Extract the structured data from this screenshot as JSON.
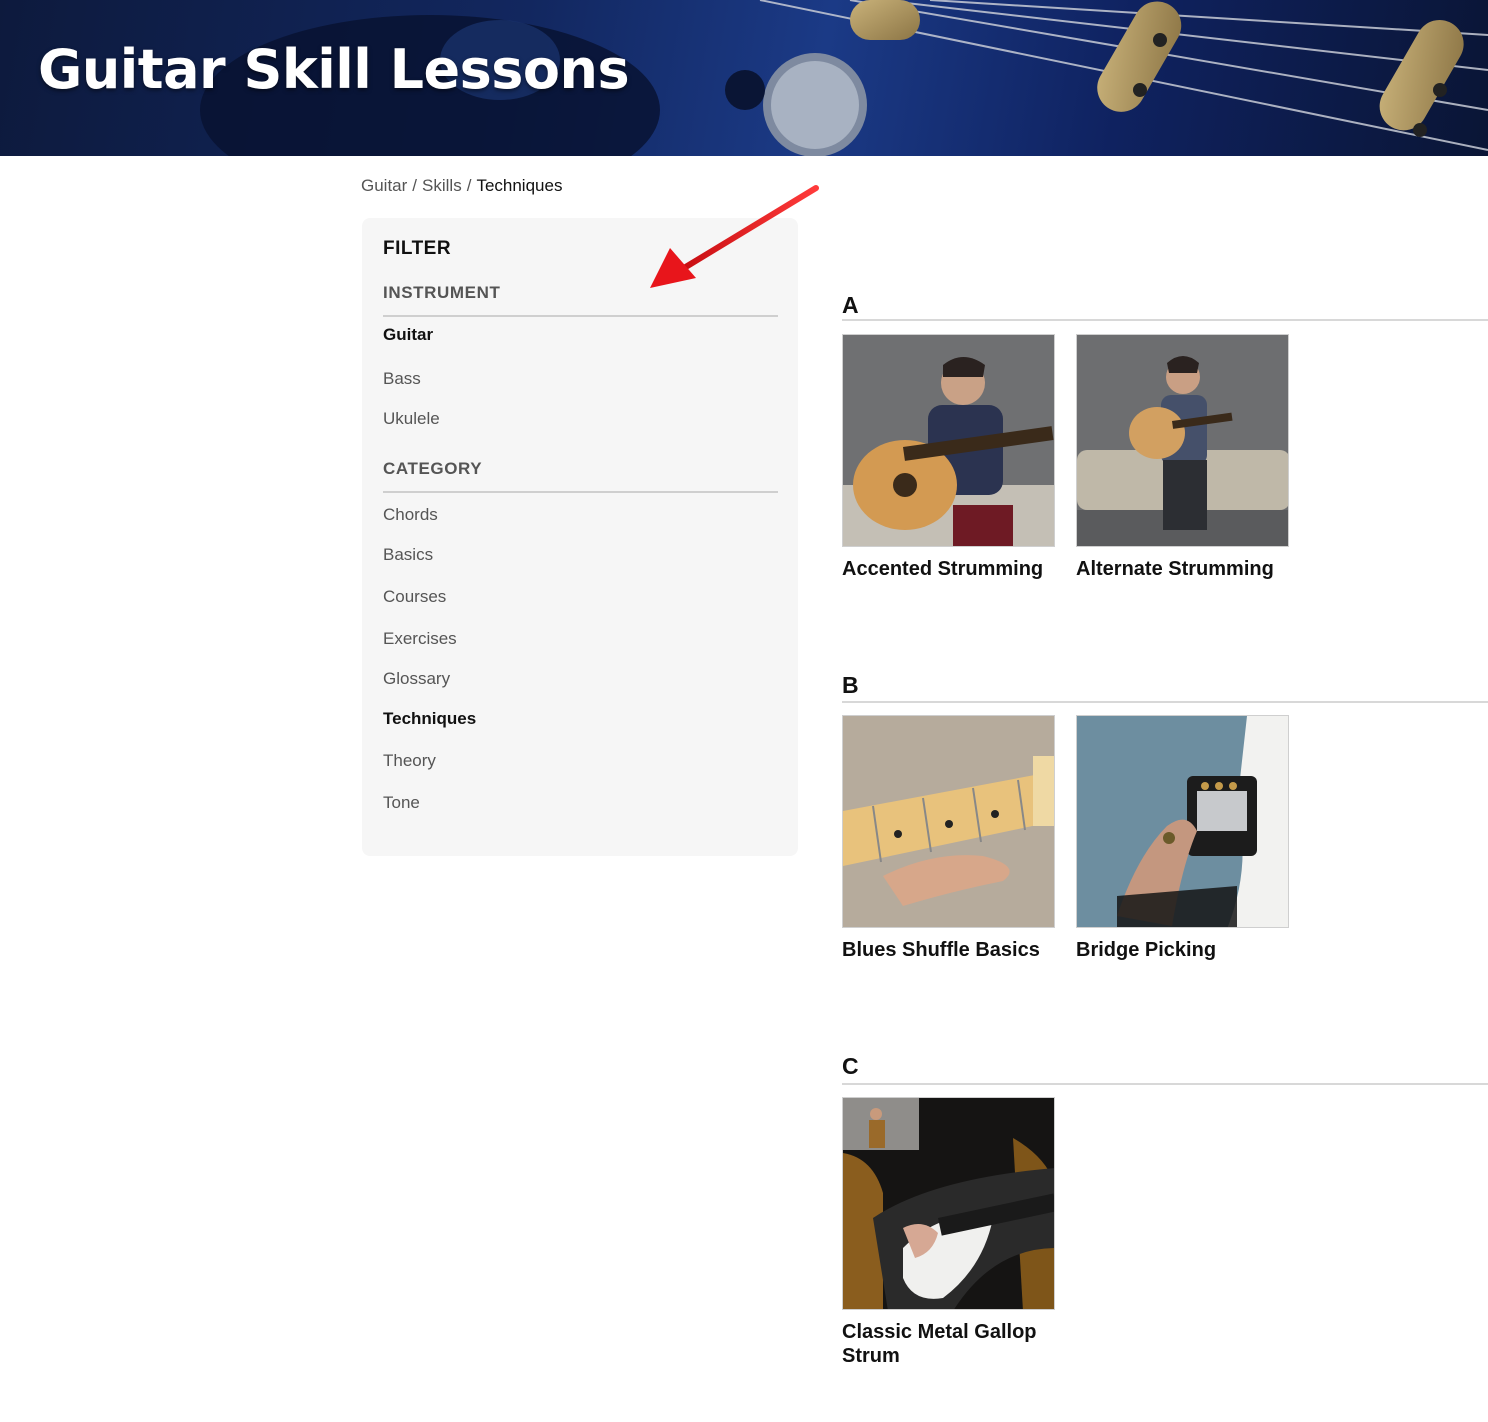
{
  "hero": {
    "title": "Guitar Skill Lessons"
  },
  "breadcrumb": {
    "items": [
      "Guitar",
      "Skills"
    ],
    "current": "Techniques"
  },
  "filter": {
    "title": "FILTER",
    "instrument": {
      "heading": "INSTRUMENT",
      "items": [
        "Guitar",
        "Bass",
        "Ukulele"
      ],
      "selected": "Guitar"
    },
    "category": {
      "heading": "CATEGORY",
      "items": [
        "Chords",
        "Basics",
        "Courses",
        "Exercises",
        "Glossary",
        "Techniques",
        "Theory",
        "Tone"
      ],
      "selected": "Techniques"
    }
  },
  "groups": [
    {
      "letter": "A",
      "lessons": [
        "Accented Strumming",
        "Alternate Strumming"
      ]
    },
    {
      "letter": "B",
      "lessons": [
        "Blues Shuffle Basics",
        "Bridge Picking"
      ]
    },
    {
      "letter": "C",
      "lessons": [
        "Classic Metal Gallop Strum"
      ]
    }
  ],
  "colors": {
    "arrow": "#e8151b",
    "panel": "#f6f6f6",
    "hero": "#12275f"
  }
}
